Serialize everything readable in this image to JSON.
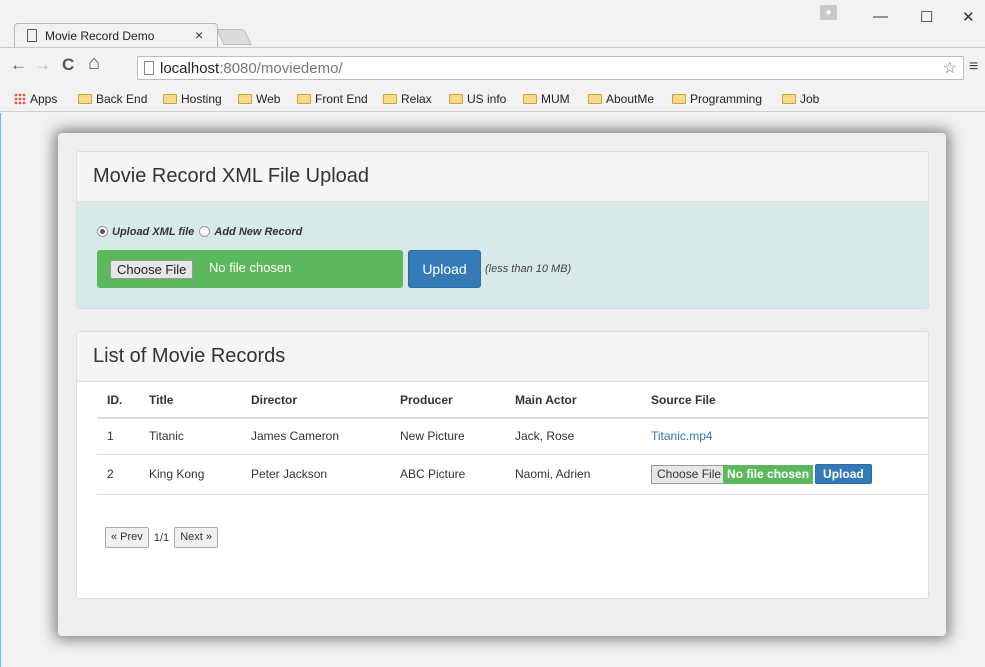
{
  "browser": {
    "tab_title": "Movie Record Demo",
    "tab_close": "×",
    "url_host": "localhost",
    "url_rest": ":8080/moviedemo/",
    "bookmarks": [
      "Back End",
      "Hosting",
      "Web",
      "Front End",
      "Relax",
      "US info",
      "MUM",
      "AboutMe",
      "Programming",
      "Job"
    ],
    "apps_label": "Apps",
    "win_min": "—",
    "win_max": "☐",
    "win_close": "✕",
    "back": "←",
    "forward": "→",
    "reload": "C",
    "home": "⌂",
    "star": "☆",
    "menu": "≡"
  },
  "upload_panel": {
    "title": "Movie Record XML File Upload",
    "radio_upload": "Upload XML file",
    "radio_add": "Add New Record",
    "choose_file": "Choose File",
    "no_file": "No file chosen",
    "upload": "Upload",
    "note": "(less than 10 MB)"
  },
  "list_panel": {
    "title": "List of Movie Records",
    "headers": [
      "ID.",
      "Title",
      "Director",
      "Producer",
      "Main Actor",
      "Source File"
    ],
    "rows": [
      {
        "id": "1",
        "title": "Titanic",
        "director": "James Cameron",
        "producer": "New Picture",
        "actor": "Jack, Rose",
        "source": "Titanic.mp4"
      },
      {
        "id": "2",
        "title": "King Kong",
        "director": "Peter Jackson",
        "producer": "ABC Picture",
        "actor": "Naomi, Adrien",
        "choose": "Choose File",
        "no_file": "No file chosen",
        "upload": "Upload"
      }
    ],
    "pager": {
      "prev": "« Prev",
      "count": "1/1",
      "next": "Next »"
    }
  }
}
